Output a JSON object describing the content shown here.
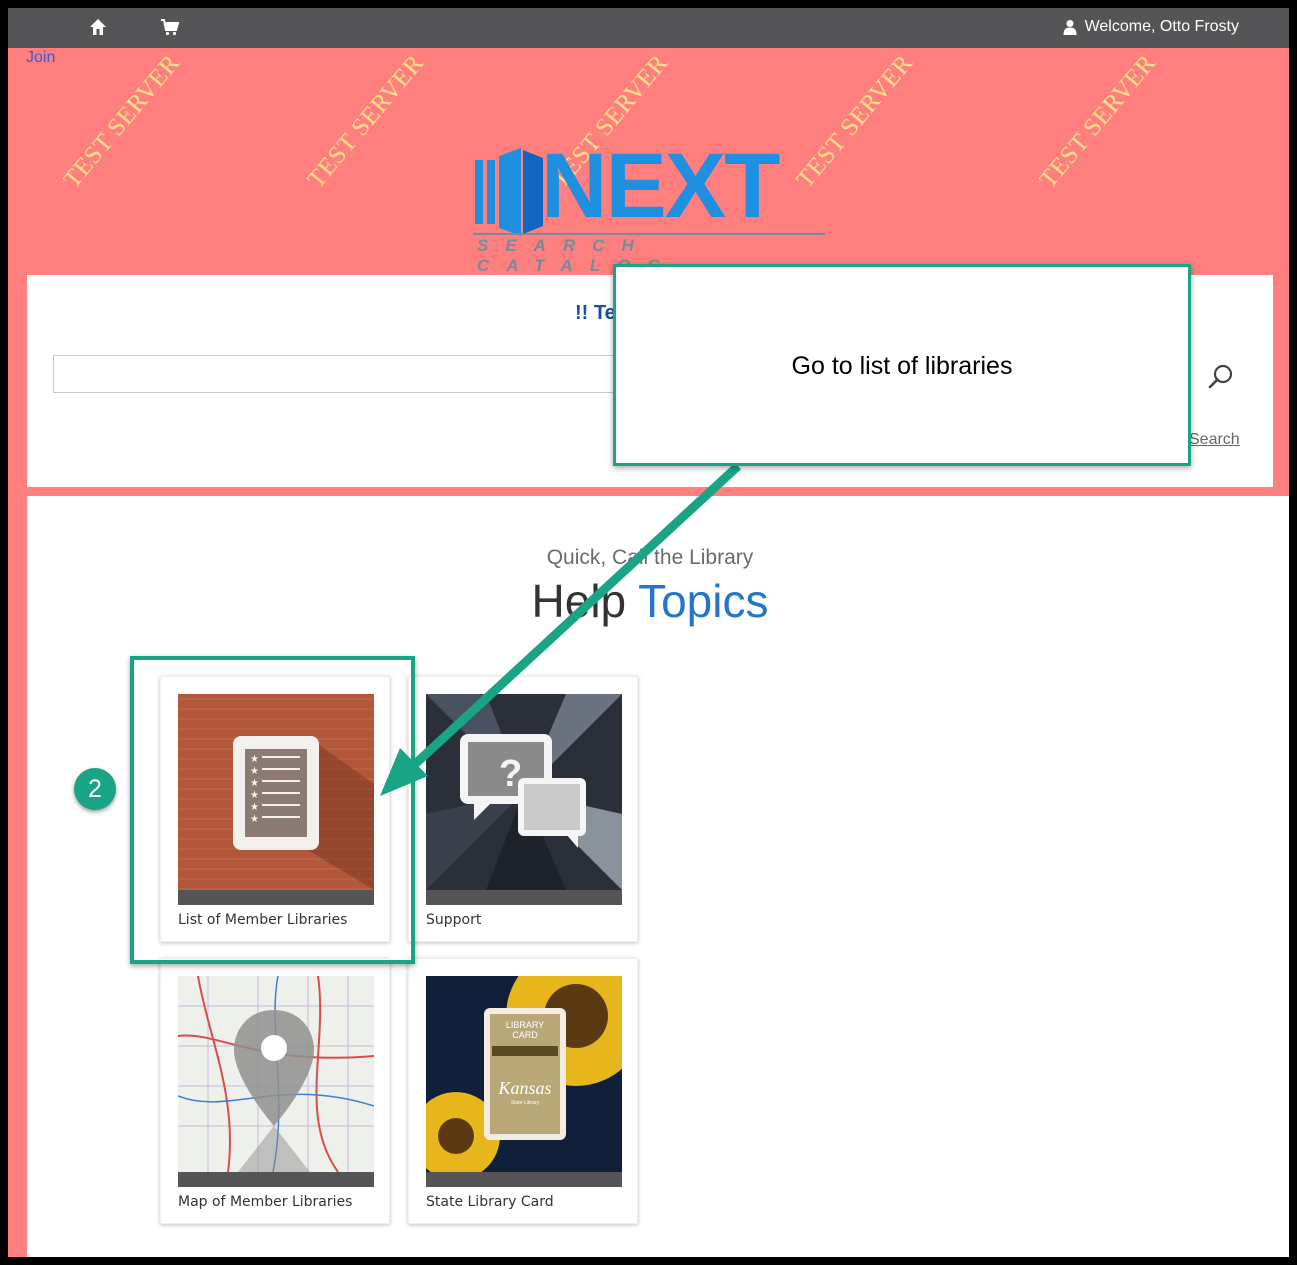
{
  "topbar": {
    "home_icon": "home-icon",
    "cart_icon": "cart-icon",
    "user_icon": "user-icon",
    "welcome": "Welcome, Otto Frosty",
    "background": "#555558"
  },
  "join": "Join",
  "watermark": "TEST SERVER",
  "logo": {
    "word": "NEXT",
    "subtitle": "SEARCH CATALOG"
  },
  "search": {
    "notice": "!! Te",
    "placeholder": "",
    "value": "",
    "advanced_link": "Search"
  },
  "help": {
    "subtitle": "Quick, Call the Library",
    "title_part1": "Help",
    "title_part2": "Topics"
  },
  "cards": [
    {
      "label": "List of Member Libraries"
    },
    {
      "label": "Support"
    },
    {
      "label": "Map of Member Libraries"
    },
    {
      "label": "State Library Card"
    }
  ],
  "library_card": {
    "line1": "LIBRARY",
    "line2": "CARD",
    "brand": "Kansas",
    "small": "State Library"
  },
  "annotation": {
    "callout": "Go to list of libraries",
    "step": "2",
    "color": "#1aa486"
  },
  "colors": {
    "page_bg": "#ff7f7f",
    "logo_blue": "#1f8fe0",
    "accent_blue": "#2575c9"
  }
}
